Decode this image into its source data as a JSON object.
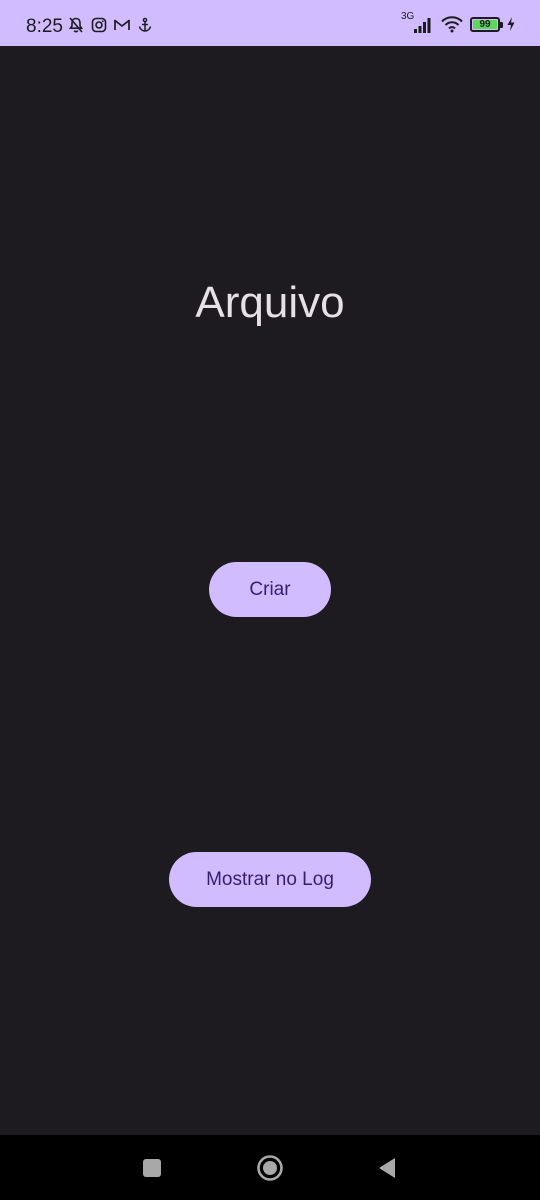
{
  "status_bar": {
    "time": "8:25",
    "network_type": "3G",
    "battery_level": "99",
    "battery_fraction": 0.99,
    "left_icons": [
      "muted-bell-icon",
      "instagram-icon",
      "gmail-icon",
      "anchor-icon"
    ],
    "right_icons": [
      "signal-icon",
      "wifi-icon",
      "battery-icon",
      "charging-icon"
    ],
    "background_color": "#d0bcff"
  },
  "main": {
    "title": "Arquivo",
    "buttons": {
      "create_label": "Criar",
      "show_log_label": "Mostrar no Log"
    },
    "background_color": "#1d1b20",
    "accent_color": "#d0bcff"
  },
  "nav_bar": {
    "icons": [
      "recent-apps-icon",
      "home-icon",
      "back-icon"
    ]
  }
}
